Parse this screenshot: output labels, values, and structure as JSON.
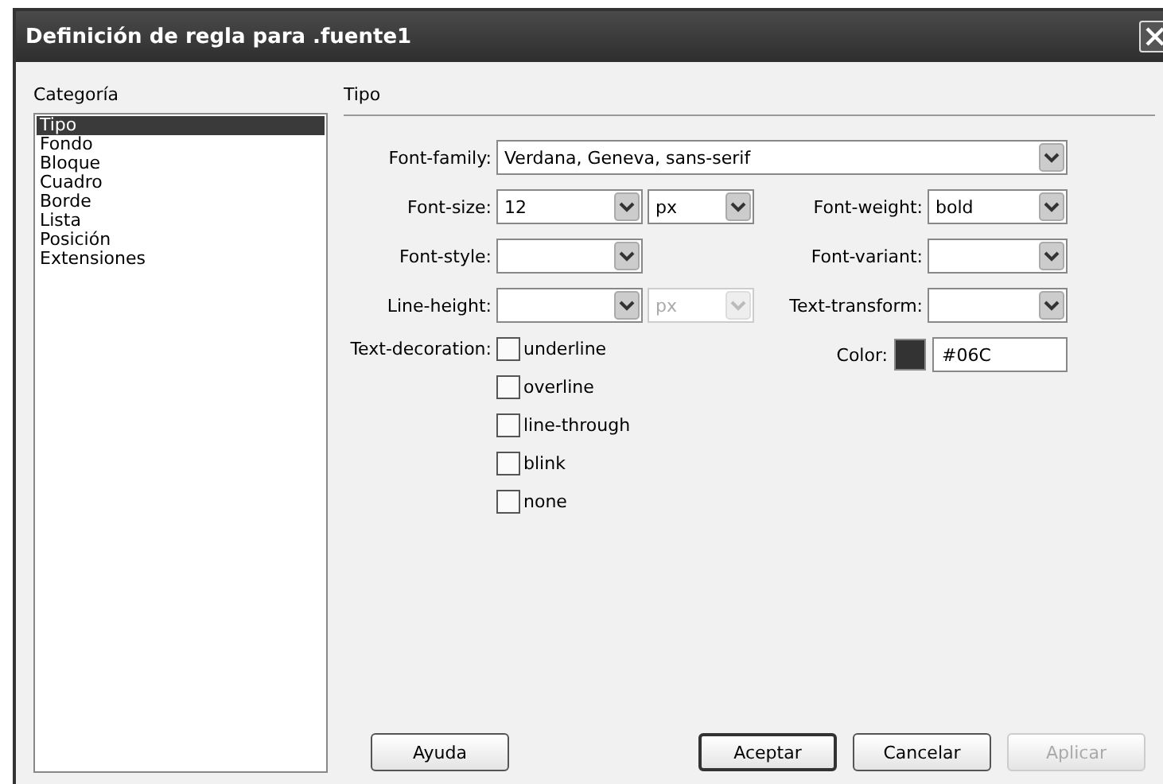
{
  "window": {
    "title": "Definición de regla para .fuente1"
  },
  "sidebar": {
    "label": "Categoría",
    "items": [
      {
        "label": "Tipo",
        "selected": true
      },
      {
        "label": "Fondo",
        "selected": false
      },
      {
        "label": "Bloque",
        "selected": false
      },
      {
        "label": "Cuadro",
        "selected": false
      },
      {
        "label": "Borde",
        "selected": false
      },
      {
        "label": "Lista",
        "selected": false
      },
      {
        "label": "Posición",
        "selected": false
      },
      {
        "label": "Extensiones",
        "selected": false
      }
    ]
  },
  "panel": {
    "heading": "Tipo"
  },
  "font_family": {
    "label": "Font-family:",
    "value": "Verdana, Geneva, sans-serif"
  },
  "rows": [
    {
      "left": {
        "label": "Font-size:",
        "value": "12"
      },
      "unit": {
        "value": "px",
        "disabled": false
      },
      "right": {
        "label": "Font-weight:",
        "value": "bold"
      }
    },
    {
      "left": {
        "label": "Font-style:"
      },
      "right": {
        "label": "Font-variant:"
      }
    },
    {
      "left": {
        "label": "Line-height:"
      },
      "unit": {
        "value": "px",
        "disabled": true
      },
      "right": {
        "label": "Text-transform:"
      }
    }
  ],
  "text_decoration": {
    "label": "Text-decoration:",
    "options": [
      {
        "label": "underline",
        "checked": false
      },
      {
        "label": "overline",
        "checked": false
      },
      {
        "label": "line-through",
        "checked": false
      },
      {
        "label": "blink",
        "checked": false
      },
      {
        "label": "none",
        "checked": false
      }
    ]
  },
  "color": {
    "label": "Color:",
    "value": "#06C"
  },
  "buttons": [
    {
      "label": "Ayuda",
      "default": false,
      "disabled": false
    },
    {
      "label": "Aceptar",
      "default": true,
      "disabled": false
    },
    {
      "label": "Cancelar",
      "default": false,
      "disabled": false
    },
    {
      "label": "Aplicar",
      "default": false,
      "disabled": true
    }
  ]
}
